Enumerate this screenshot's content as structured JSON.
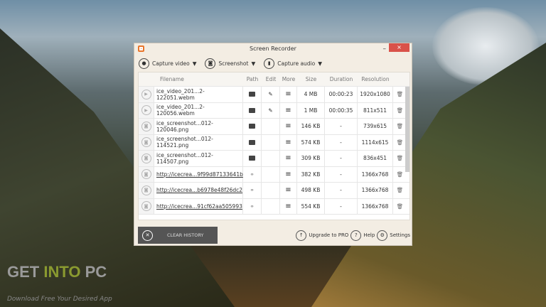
{
  "window": {
    "title": "Screen Recorder",
    "close": "×",
    "minimize": "–"
  },
  "toolbar": {
    "capture_video": "Capture video",
    "screenshot": "Screenshot",
    "capture_audio": "Capture audio"
  },
  "columns": [
    "Filename",
    "Path",
    "Edit",
    "More",
    "Size",
    "Duration",
    "Resolution"
  ],
  "rows": [
    {
      "type": "video",
      "name": "ice_video_201...2-122051.webm",
      "path": "folder",
      "edit": true,
      "size": "4 MB",
      "duration": "00:00:23",
      "resolution": "1920x1080"
    },
    {
      "type": "video",
      "name": "ice_video_201...2-120056.webm",
      "path": "folder",
      "edit": true,
      "size": "1 MB",
      "duration": "00:00:35",
      "resolution": "811x511"
    },
    {
      "type": "shot",
      "name": "ice_screenshot...012-120046.png",
      "path": "folder",
      "edit": false,
      "size": "146 KB",
      "duration": "-",
      "resolution": "739x615"
    },
    {
      "type": "shot",
      "name": "ice_screenshot...012-114521.png",
      "path": "folder",
      "edit": false,
      "size": "574 KB",
      "duration": "-",
      "resolution": "1114x615"
    },
    {
      "type": "shot",
      "name": "ice_screenshot...012-114507.png",
      "path": "folder",
      "edit": false,
      "size": "309 KB",
      "duration": "-",
      "resolution": "836x451"
    },
    {
      "type": "shot",
      "name": "http://icecrea...9f99d87133641b",
      "path": "link",
      "edit": false,
      "size": "382 KB",
      "duration": "-",
      "resolution": "1366x768"
    },
    {
      "type": "shot",
      "name": "http://icecrea...b6978e48f26dc2",
      "path": "link",
      "edit": false,
      "size": "498 KB",
      "duration": "-",
      "resolution": "1366x768"
    },
    {
      "type": "shot",
      "name": "http://icecrea...91cf62aa505993",
      "path": "link",
      "edit": false,
      "size": "554 KB",
      "duration": "-",
      "resolution": "1366x768"
    }
  ],
  "footer": {
    "clear_history": "CLEAR HISTORY",
    "upgrade": "Upgrade to PRO",
    "help": "Help",
    "settings": "Settings"
  },
  "watermark": {
    "brand": "GET INTO PC",
    "brand_a": "GET ",
    "brand_b": "INTO",
    "brand_c": " PC",
    "tagline": "Download Free Your Desired App"
  }
}
